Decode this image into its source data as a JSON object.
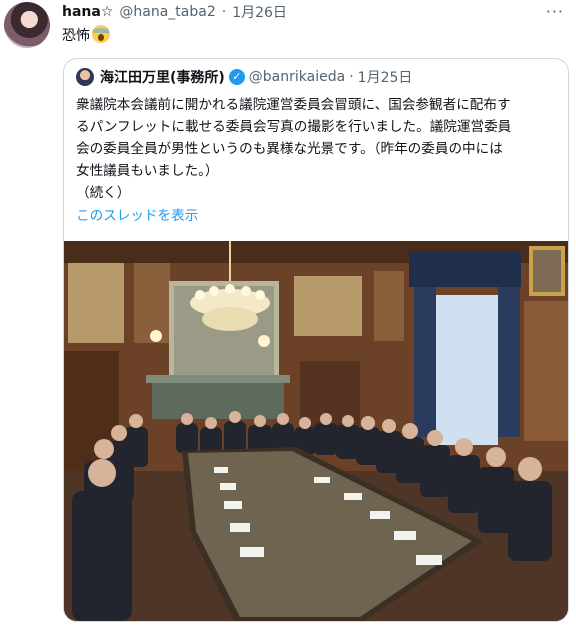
{
  "tweet": {
    "author_name": "hana☆",
    "handle": "@hana_taba2",
    "separator": "·",
    "date": "1月26日",
    "text": "恐怖",
    "emoji_icon": "face-screaming-icon",
    "more_label": "···"
  },
  "quote": {
    "author_name": "海江田万里(事務所)",
    "verified_icon": "verified-badge-icon",
    "handle": "@banrikaieda",
    "separator": "·",
    "date": "1月25日",
    "lines": [
      "衆議院本会議前に開かれる議院運営委員会冒頭に、国会参観者に配布す",
      "るパンフレットに載せる委員会写真の撮影を行いました。議院運営委員",
      "会の委員全員が男性というのも異様な光景です。（昨年の委員の中には",
      "女性議員もいました。）",
      "（続く）"
    ],
    "thread_link": "このスレッドを表示"
  },
  "colors": {
    "link": "#1d9bf0",
    "muted": "#536471",
    "border": "#cfd9de"
  }
}
